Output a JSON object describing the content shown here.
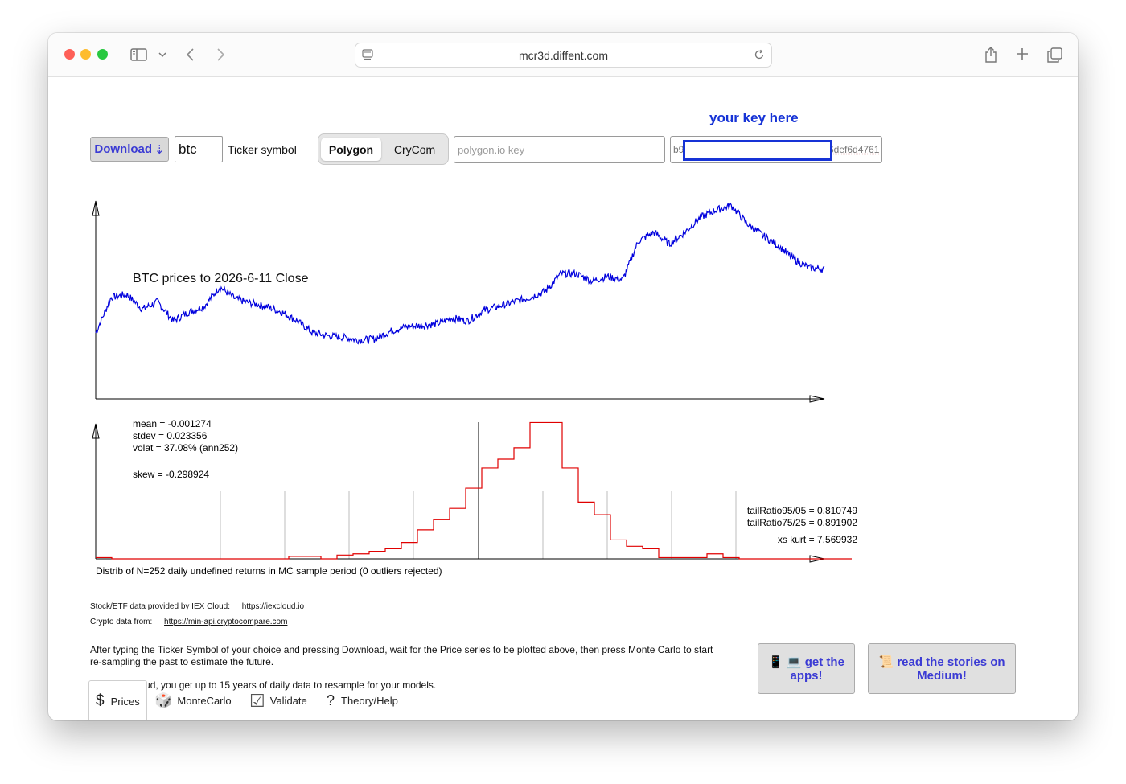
{
  "browser": {
    "url": "mcr3d.diffent.com"
  },
  "toolbar": {
    "download_label": "Download",
    "download_arrow": "⇣",
    "ticker_value": "btc",
    "ticker_label": "Ticker symbol",
    "sources": [
      "Polygon",
      "CryCom"
    ],
    "selected_source": "Polygon",
    "key_placeholder": "polygon.io key",
    "key_value_prefix": "b9",
    "key_value_suffix": "6def6d4761",
    "key_annotation": "your key here"
  },
  "price_chart": {
    "title": "BTC prices to 2026-6-11 Close"
  },
  "distribution_chart": {
    "stats": [
      "mean = -0.001274",
      "stdev = 0.023356",
      "volat = 37.08% (ann252)"
    ],
    "skew": "skew = -0.298924",
    "tail_ratio_95": "tailRatio95/05 = 0.810749",
    "tail_ratio_75": "tailRatio75/25 = 0.891902",
    "xs_kurt": "xs kurt = 7.569932",
    "caption": "Distrib of N=252 daily undefined returns in MC sample period (0 outliers rejected)"
  },
  "chart_data": [
    {
      "type": "line",
      "title": "BTC prices to 2026-6-11 Close",
      "xlabel": "",
      "ylabel": "",
      "series": [
        {
          "values": [
            0.12,
            0.36,
            0.38,
            0.28,
            0.33,
            0.2,
            0.26,
            0.3,
            0.43,
            0.35,
            0.32,
            0.3,
            0.26,
            0.2,
            0.12,
            0.1,
            0.09,
            0.07,
            0.08,
            0.13,
            0.16,
            0.17,
            0.18,
            0.22,
            0.2,
            0.27,
            0.3,
            0.33,
            0.36,
            0.4,
            0.52,
            0.52,
            0.47,
            0.5,
            0.48,
            0.74,
            0.8,
            0.72,
            0.8,
            0.9,
            0.95,
            0.98,
            0.86,
            0.78,
            0.71,
            0.62,
            0.56,
            0.55
          ]
        }
      ],
      "grid": false
    },
    {
      "type": "bar",
      "title": "",
      "xlabel": "",
      "ylabel": "",
      "series": [
        {
          "values": [
            1,
            0,
            0,
            0,
            0,
            0,
            0,
            0,
            0,
            0,
            0,
            0,
            2,
            2,
            0,
            3,
            4,
            6,
            8,
            13,
            23,
            31,
            40,
            56,
            72,
            79,
            88,
            108,
            108,
            72,
            45,
            35,
            15,
            10,
            8,
            1,
            1,
            1,
            4,
            1,
            0,
            0,
            0,
            0,
            0,
            0,
            0
          ]
        }
      ],
      "grid": true
    }
  ],
  "footer": {
    "iex_label": "Stock/ETF data provided by IEX Cloud:",
    "iex_link": "https://iexcloud.io",
    "crypto_label": "Crypto data from:",
    "crypto_link": "https://min-api.cryptocompare.com",
    "instructions_line1": "After typing the Ticker Symbol of your choice and pressing Download, wait for the Price series to be plotted above, then press Monte Carlo to start",
    "instructions_line2": "re-sampling the past to estimate the future.",
    "iex_note": "With IEX Cloud, you get up to 15 years of daily data to resample for your models.",
    "apps_icons": "📱 💻",
    "apps_line1": "get the",
    "apps_line2": "apps!",
    "medium_icon": "📜",
    "medium_line1": "read the stories on",
    "medium_line2": "Medium!"
  },
  "tabs": [
    {
      "icon": "$",
      "label": "Prices"
    },
    {
      "icon": "🎲",
      "label": "MonteCarlo"
    },
    {
      "icon": "☑",
      "label": "Validate"
    },
    {
      "icon": "?",
      "label": "Theory/Help"
    }
  ],
  "colors": {
    "price_line": "#0000dd",
    "histogram": "#e00000",
    "link_blue": "#3b3bd4",
    "annotation_blue": "#1633d6"
  }
}
